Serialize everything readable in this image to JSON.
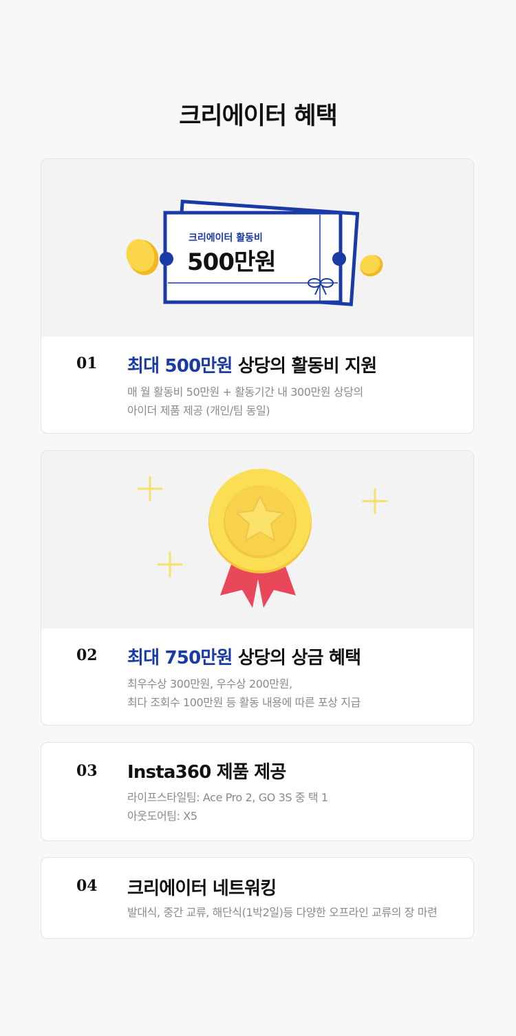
{
  "page": {
    "title": "크리에이터 혜택"
  },
  "ticket": {
    "label": "크리에이터 활동비",
    "amount": "500만원"
  },
  "benefits": [
    {
      "number": "01",
      "headline_accent": "최대 500만원",
      "headline_rest": " 상당의 활동비 지원",
      "desc_lines": [
        "매 월 활동비 50만원 + 활동기간 내 300만원 상당의",
        "아이더 제품 제공 (개인/팀 동일)"
      ]
    },
    {
      "number": "02",
      "headline_accent": "최대 750만원",
      "headline_rest": " 상당의 상금 혜택",
      "desc_lines": [
        "최우수상 300만원, 우수상 200만원,",
        "최다 조회수 100만원 등 활동 내용에 따른 포상 지급"
      ]
    },
    {
      "number": "03",
      "headline_accent": "",
      "headline_rest": "Insta360 제품 제공",
      "desc_lines": [
        "라이프스타일팀: Ace Pro 2, GO 3S 중 택 1",
        "아웃도어팀: X5"
      ]
    },
    {
      "number": "04",
      "headline_accent": "",
      "headline_rest": "크리에이터 네트워킹",
      "desc_lines": [
        "발대식, 중간 교류, 해단식(1박2일)등 다양한 오프라인 교류의 장 마련"
      ]
    }
  ],
  "colors": {
    "accent": "#1a3aa6",
    "coin": "#f7c531",
    "ribbon": "#e8485a",
    "sparkle": "#f5e06a"
  },
  "icons": [
    "coin-icon",
    "ticket-icon",
    "medal-icon",
    "star-icon",
    "sparkle-icon"
  ]
}
